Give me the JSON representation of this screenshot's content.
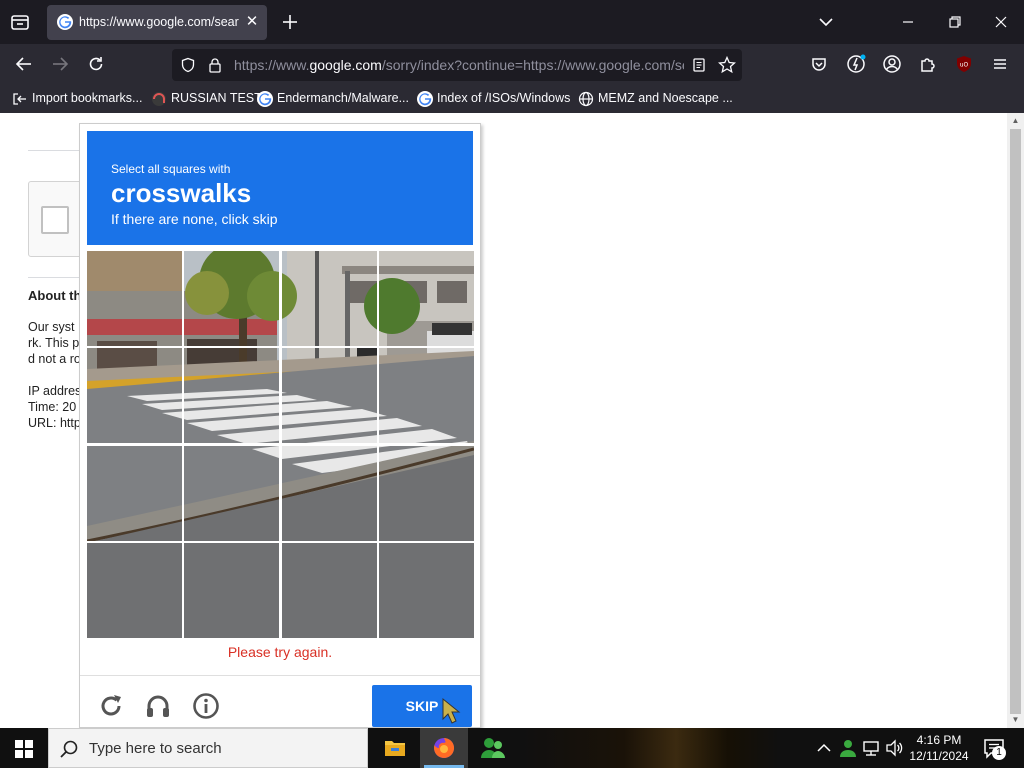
{
  "browser": {
    "tab": {
      "title": "https://www.google.com/search?q="
    },
    "url": {
      "prefix": "https://www.",
      "host": "google.com",
      "suffix": "/sorry/index?continue=https://www.google.com/search"
    },
    "bookmarks": [
      {
        "label": "Import bookmarks...",
        "icon": "import-icon"
      },
      {
        "label": "RUSSIAN TEST",
        "icon": "github-icon"
      },
      {
        "label": "Endermanch/Malware...",
        "icon": "google-icon"
      },
      {
        "label": "Index of /ISOs/Windows",
        "icon": "google-icon"
      },
      {
        "label": "MEMZ and Noescape ...",
        "icon": "globe-icon"
      }
    ],
    "colors": {
      "tabbar": "#1c1b22",
      "navbar": "#2b2a33",
      "tab": "#42414d"
    }
  },
  "page": {
    "about_heading": "About th",
    "text_lines": [
      "Our syst",
      "rk. This p",
      "d not a ro"
    ],
    "info_lines": [
      "IP addres",
      "Time: 20",
      "URL: http"
    ]
  },
  "captcha": {
    "instruction": "Select all squares with",
    "target": "crosswalks",
    "hint": "If there are none, click skip",
    "error": "Please try again.",
    "skip_label": "SKIP",
    "grid_size": 4,
    "colors": {
      "header": "#1a73e8",
      "error": "#d93025",
      "button": "#1a73e8"
    }
  },
  "taskbar": {
    "search_placeholder": "Type here to search",
    "time": "4:16 PM",
    "date": "12/11/2024",
    "notification_count": "1"
  }
}
